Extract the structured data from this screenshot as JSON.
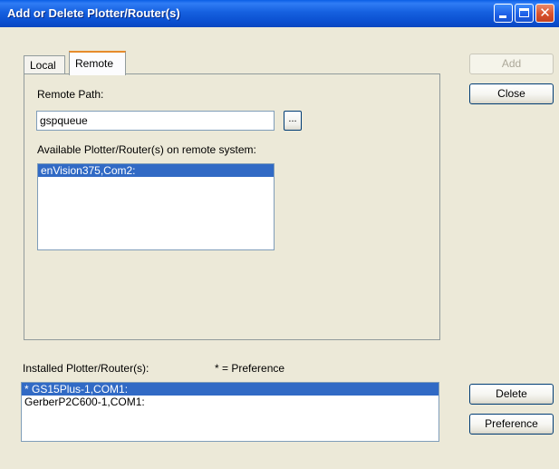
{
  "window": {
    "title": "Add or Delete Plotter/Router(s)"
  },
  "tabs": [
    {
      "label": "Local",
      "active": false
    },
    {
      "label": "Remote",
      "active": true
    }
  ],
  "remote": {
    "path_label": "Remote Path:",
    "path_value": "gspqueue",
    "browse_label": "...",
    "available_label": "Available Plotter/Router(s) on remote system:",
    "available_items": [
      {
        "label": "enVision375,Com2:",
        "selected": true
      }
    ]
  },
  "installed": {
    "label": "Installed Plotter/Router(s):",
    "preference_note": "* = Preference",
    "items": [
      {
        "label": "* GS15Plus-1,COM1:",
        "selected": true
      },
      {
        "label": "GerberP2C600-1,COM1:",
        "selected": false
      }
    ]
  },
  "buttons": {
    "add": "Add",
    "close": "Close",
    "delete": "Delete",
    "preference": "Preference"
  },
  "colors": {
    "selection": "#316ac5",
    "titlebar": "#0a5fe5",
    "face": "#ece9d8"
  }
}
